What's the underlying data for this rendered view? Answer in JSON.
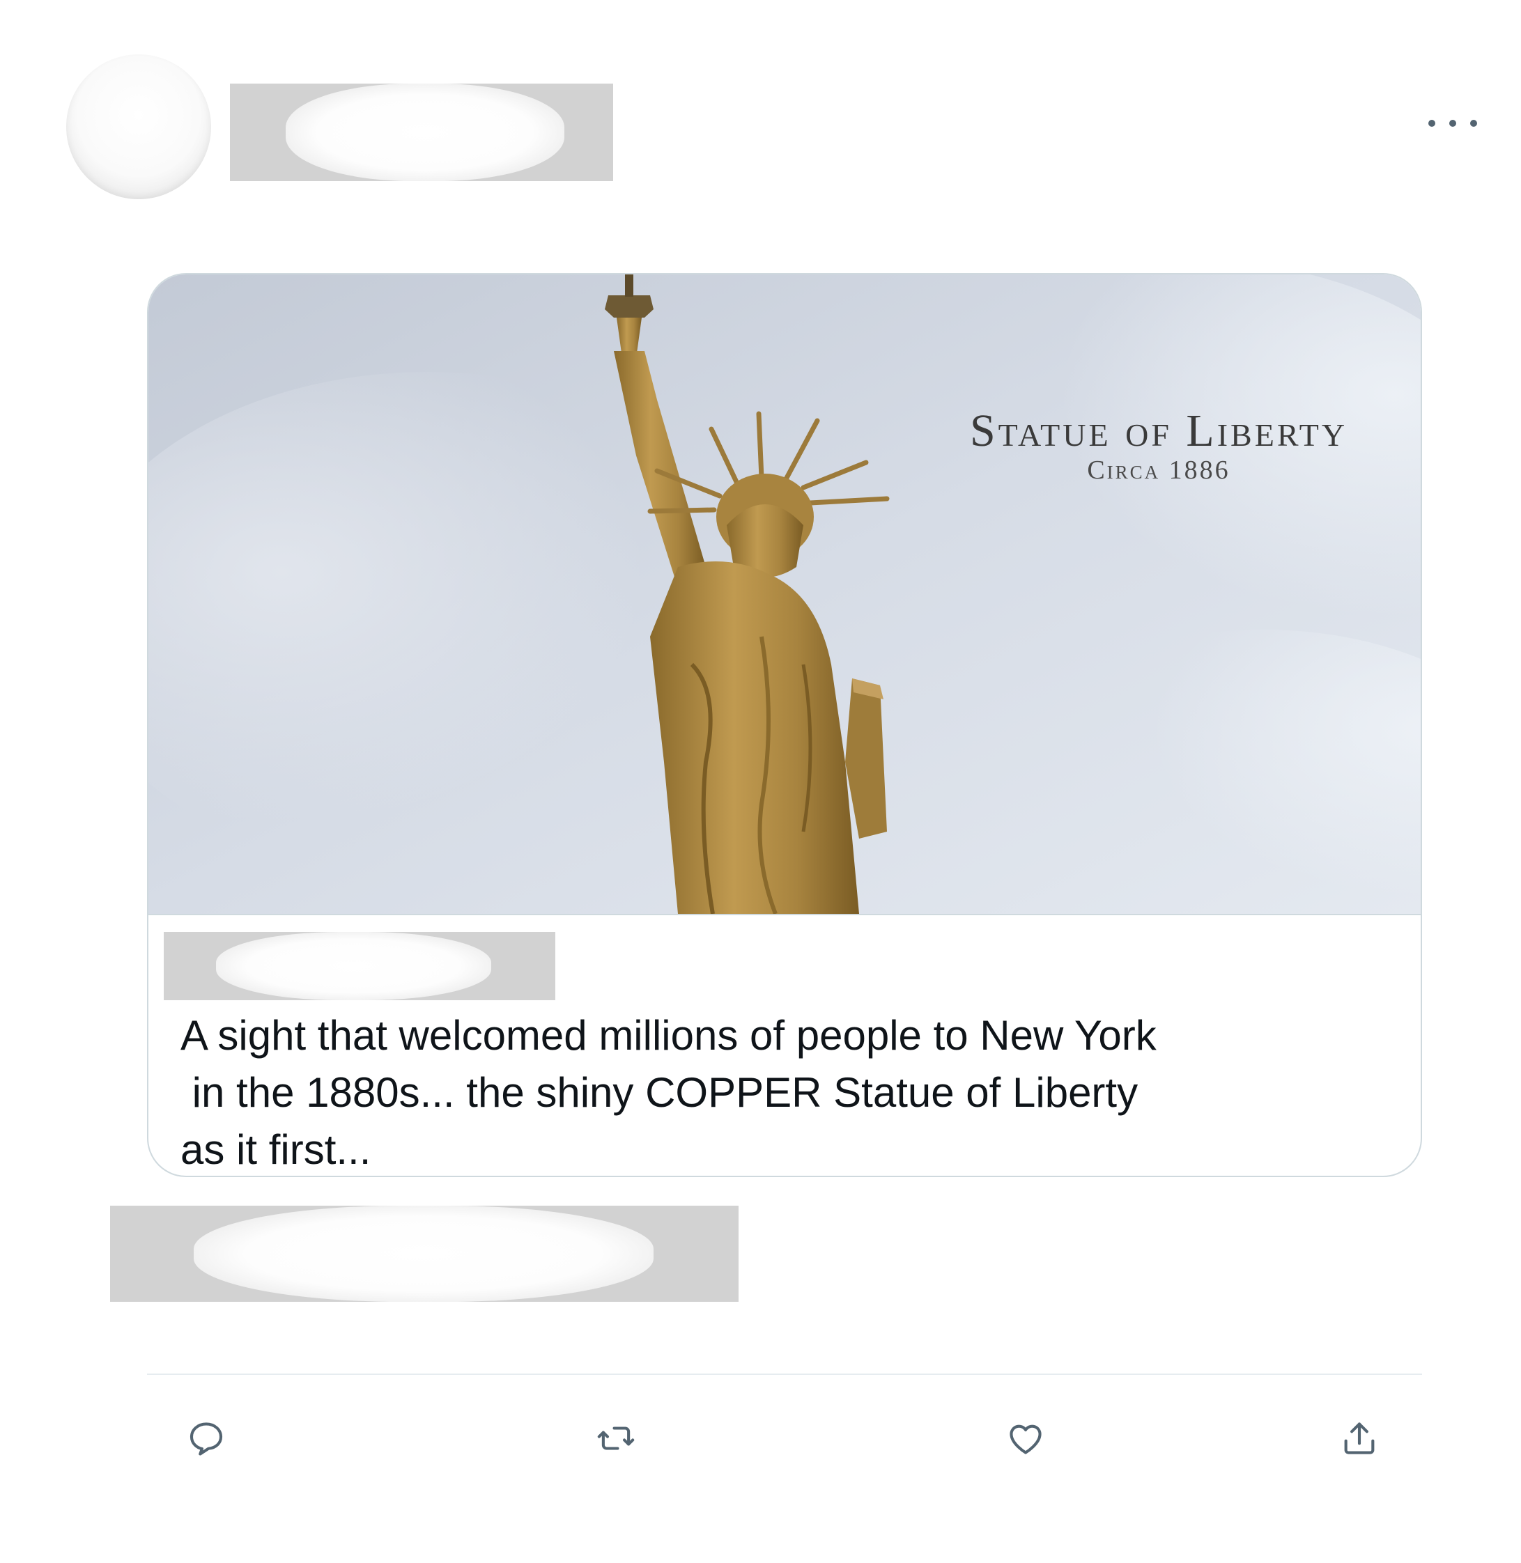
{
  "tweet": {
    "card": {
      "image_title": "Statue of Liberty",
      "image_subtitle": "Circa 1886",
      "description_lines": [
        "A sight that welcomed millions of people to New York",
        " in the 1880s... the shiny COPPER Statue of Liberty",
        "as it first..."
      ]
    },
    "actions": {
      "reply_icon": "reply-icon",
      "retweet_icon": "retweet-icon",
      "like_icon": "heart-icon",
      "share_icon": "share-icon"
    },
    "more_icon": "more-horizontal-icon"
  },
  "colors": {
    "icon": "#536471",
    "border": "#cfd9de",
    "text": "#0f1419",
    "statue": "#b08a3e",
    "sky": "#d4dbe5"
  }
}
